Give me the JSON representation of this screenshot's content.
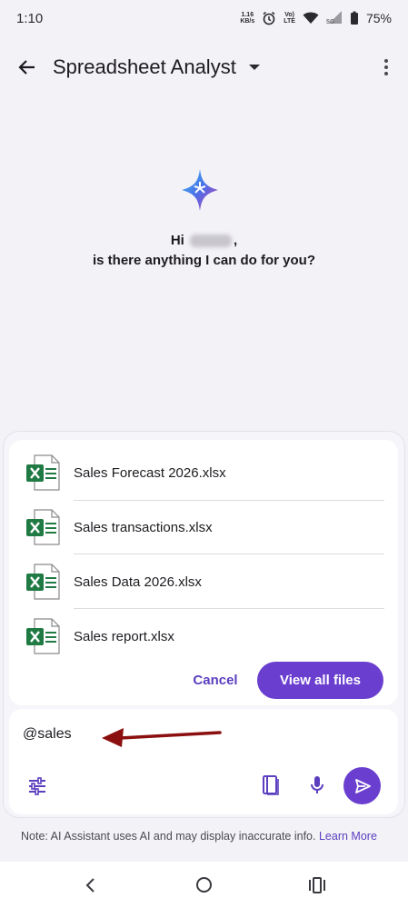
{
  "status_bar": {
    "time": "1:10",
    "net_speed_value": "1.16",
    "net_speed_unit": "KB/s",
    "volte": "Vo)",
    "lte": "LTE",
    "network": "5G",
    "battery": "75%"
  },
  "app_bar": {
    "title": "Spreadsheet Analyst"
  },
  "greeting": {
    "line1_prefix": "Hi",
    "line1_suffix": ",",
    "line2": "is there anything I can do for you?"
  },
  "files": [
    {
      "name": "Sales Forecast 2026.xlsx",
      "icon": "excel-file-icon"
    },
    {
      "name": "Sales transactions.xlsx",
      "icon": "excel-file-icon"
    },
    {
      "name": "Sales Data 2026.xlsx",
      "icon": "excel-file-icon"
    },
    {
      "name": "Sales report.xlsx",
      "icon": "excel-file-icon"
    }
  ],
  "actions": {
    "cancel": "Cancel",
    "view_all": "View all files"
  },
  "input": {
    "value": "@sales"
  },
  "note": {
    "text": "Note: AI Assistant uses AI and may display inaccurate info.",
    "link": "Learn More"
  },
  "colors": {
    "accent": "#6a3fcf",
    "annotation_arrow": "#8b0f0f",
    "excel_green": "#1f7a43"
  }
}
